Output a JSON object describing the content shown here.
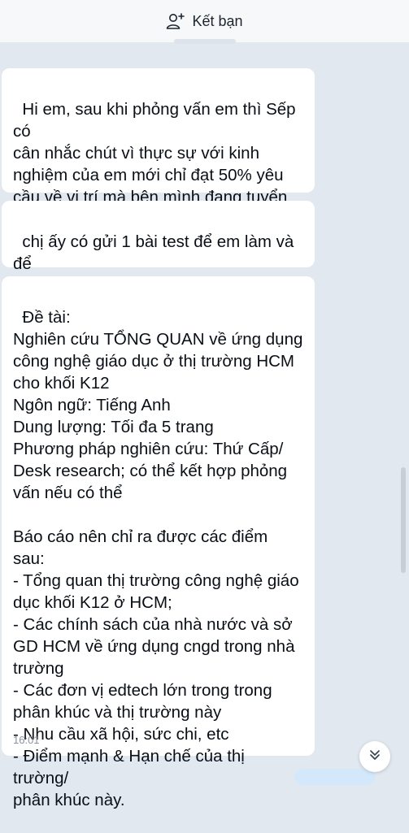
{
  "header": {
    "add_friend_label": "Kết bạn",
    "icon": "add-user-icon"
  },
  "messages": [
    {
      "text": "Hi em, sau khi phỏng vấn em thì Sếp có\ncân nhắc chút vì thực sự với kinh\nnghiệm của em mới chỉ đạt 50% yêu\ncầu về vị trí mà bên mình đang tuyển\ndụng"
    },
    {
      "text": "chị ấy có gửi 1 bài test để em làm và để\ncân nhắc nha"
    },
    {
      "text": "Đề tài:\nNghiên cứu TỔNG QUAN về ứng dụng\ncông nghệ giáo dục ở thị trường HCM\ncho khối K12\nNgôn ngữ: Tiếng Anh\nDung lượng: Tối đa 5 trang\nPhương pháp nghiên cứu: Thứ Cấp/\nDesk research; có thể kết hợp phỏng\nvấn nếu có thể\n\nBáo cáo nên chỉ ra được các điểm sau:\n- Tổng quan thị trường công nghệ giáo\ndục khối K12 ở HCM;\n- Các chính sách của nhà nước và sở\nGD HCM về ứng dụng cngd trong nhà\ntrường\n- Các đơn vị edtech lớn trong trong\nphân khúc và thị trường này\n- Nhu cầu xã hội, sức chi, etc\n- Điểm mạnh & Hạn chế của thị trường/\nphân khúc này.",
      "time": "16:01"
    }
  ],
  "scroll_button_icon": "double-chevron-down-icon",
  "colors": {
    "background": "#e2e8ef",
    "bubble": "#ffffff",
    "timestamp": "#8a939e"
  }
}
